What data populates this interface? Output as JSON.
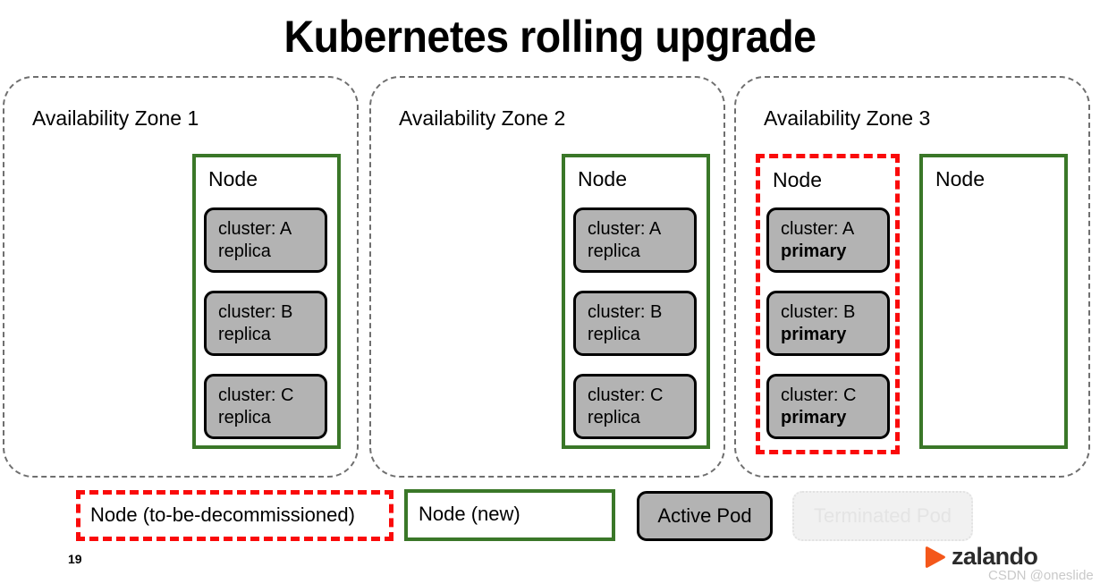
{
  "slide": {
    "title": "Kubernetes rolling upgrade",
    "number": "19"
  },
  "colors": {
    "node_new_border": "#3a7728",
    "node_decommissioned_border": "#fa0a0a",
    "pod_active_fill": "#b3b3b3",
    "pod_terminated_fill": "#f1f1f1",
    "pod_terminated_text": "#e4e4e4",
    "zone_border": "#6f6f6f",
    "brand_orange": "#f4571a",
    "watermark_text": "#c9c9c9"
  },
  "zones": [
    {
      "label": "Availability Zone 1",
      "nodes": [
        {
          "label": "Node",
          "state": "new",
          "pods": [
            {
              "cluster": "cluster: A",
              "role": "replica",
              "role_bold": false
            },
            {
              "cluster": "cluster: B",
              "role": "replica",
              "role_bold": false
            },
            {
              "cluster": "cluster: C",
              "role": "replica",
              "role_bold": false
            }
          ]
        }
      ]
    },
    {
      "label": "Availability Zone 2",
      "nodes": [
        {
          "label": "Node",
          "state": "new",
          "pods": [
            {
              "cluster": "cluster: A",
              "role": "replica",
              "role_bold": false
            },
            {
              "cluster": "cluster: B",
              "role": "replica",
              "role_bold": false
            },
            {
              "cluster": "cluster: C",
              "role": "replica",
              "role_bold": false
            }
          ]
        }
      ]
    },
    {
      "label": "Availability Zone 3",
      "nodes": [
        {
          "label": "Node",
          "state": "to-be-decommissioned",
          "pods": [
            {
              "cluster": "cluster: A",
              "role": "primary",
              "role_bold": true
            },
            {
              "cluster": "cluster: B",
              "role": "primary",
              "role_bold": true
            },
            {
              "cluster": "cluster: C",
              "role": "primary",
              "role_bold": true
            }
          ]
        },
        {
          "label": "Node",
          "state": "new",
          "pods": []
        }
      ]
    }
  ],
  "legend": {
    "decommissioned_node": "Node (to-be-decommissioned)",
    "new_node": "Node (new)",
    "active_pod": "Active Pod",
    "terminated_pod": "Terminated Pod"
  },
  "branding": {
    "wordmark": "zalando",
    "mark_icon": "zalando-triangle-icon",
    "watermark": "CSDN @oneslide"
  }
}
